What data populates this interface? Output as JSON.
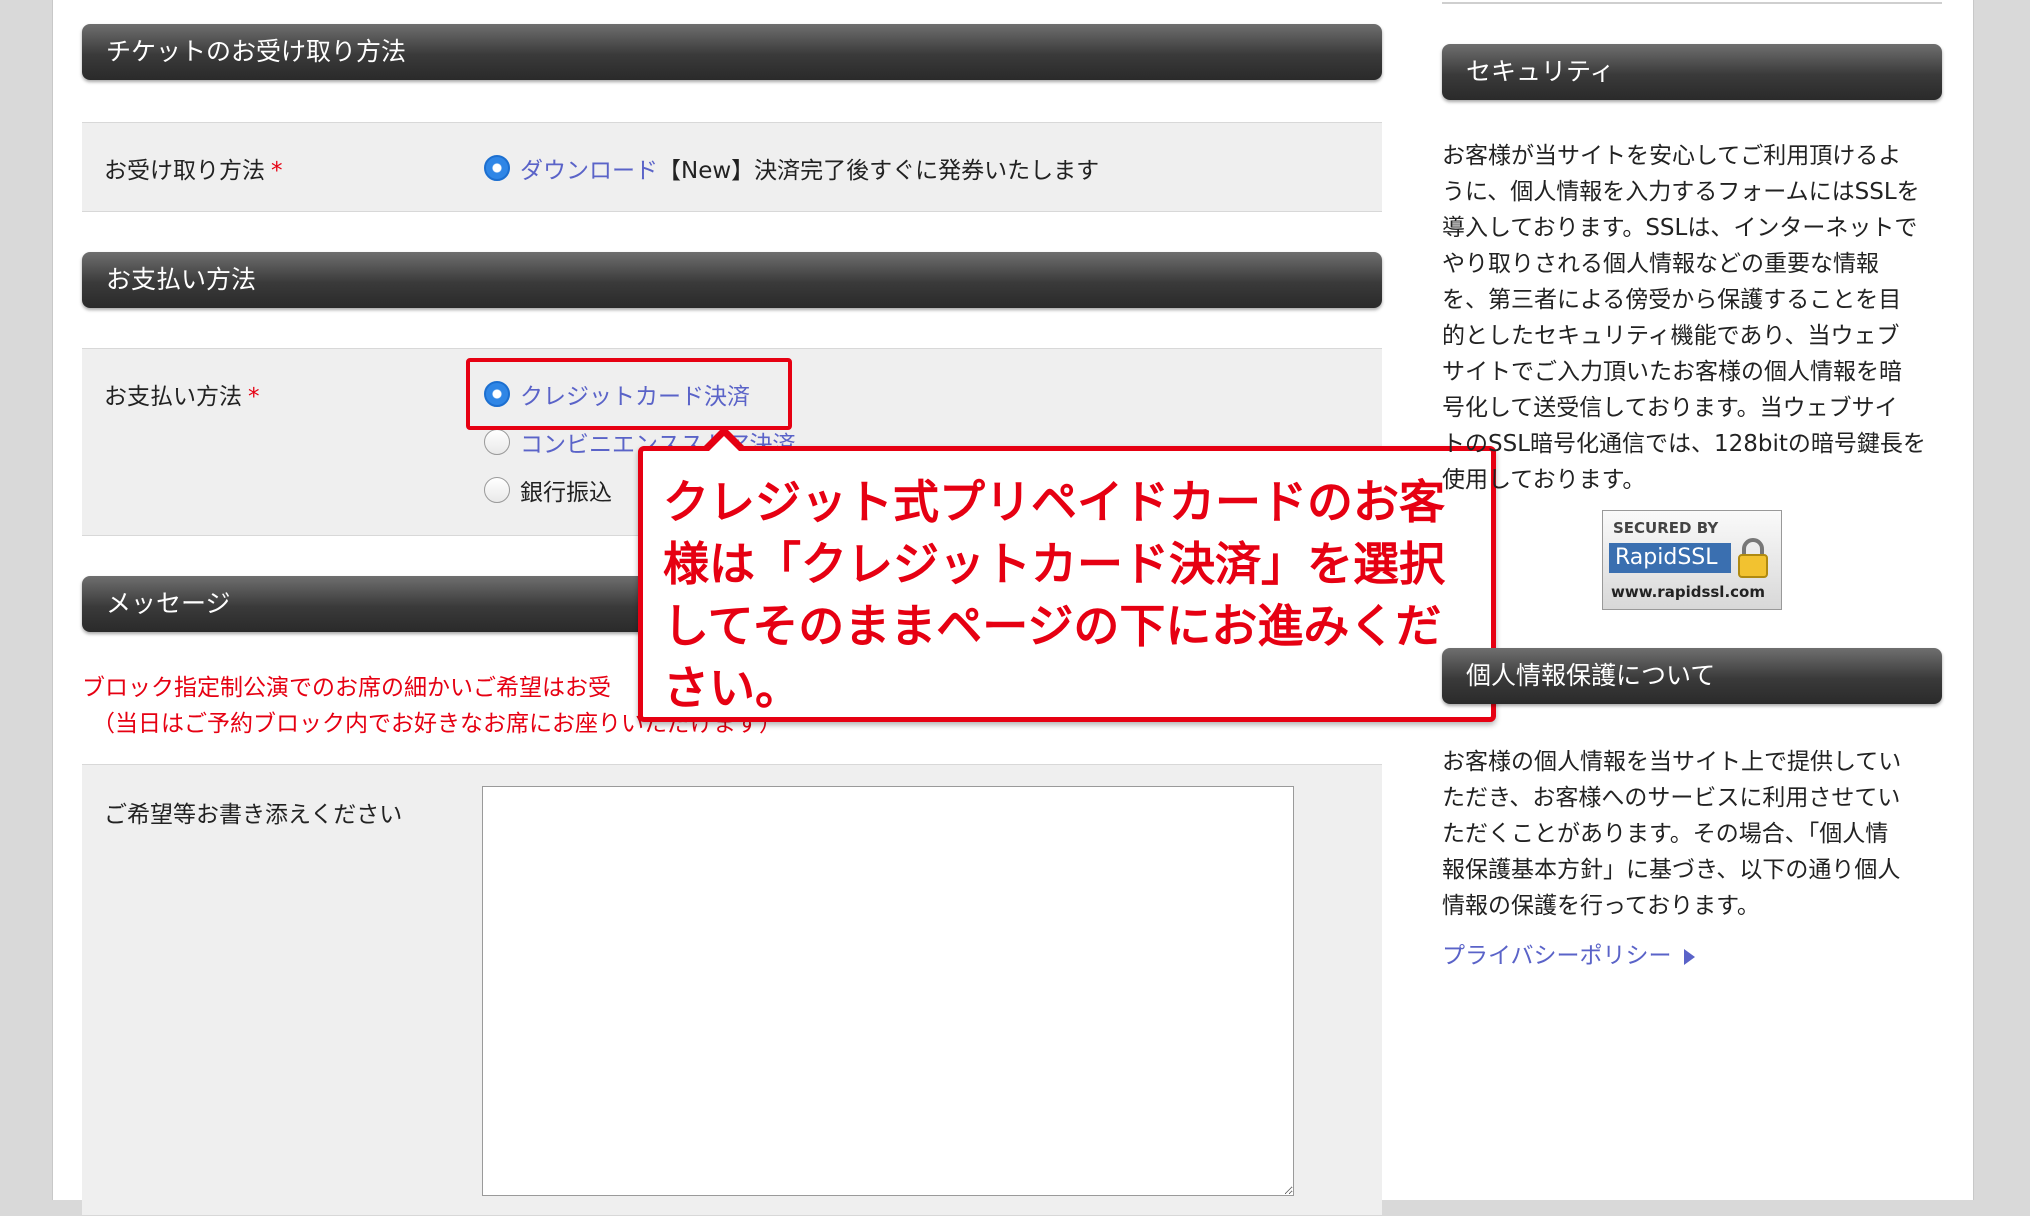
{
  "main": {
    "section_ticket": "チケットのお受け取り方法",
    "receive_label": "お受け取り方法",
    "required_mark": "*",
    "receive_option_link": "ダウンロード",
    "receive_option_text": "【New】決済完了後すぐに発券いたします",
    "section_payment": "お支払い方法",
    "payment_label": "お支払い方法",
    "payment_options": [
      "クレジットカード決済",
      "コンビニエンスストア決済",
      "銀行振込"
    ],
    "section_message": "メッセージ",
    "message_note_line1": "ブロック指定制公演でのお席の細かいご希望はお受",
    "message_note_line2": "（当日はご予約ブロック内でお好きなお席にお座りいただけます）",
    "message_field_label": "ご希望等お書き添えください"
  },
  "callout": {
    "text": "クレジット式プリペイドカードのお客様は「クレジットカード決済」を選択してそのままページの下にお進みください。"
  },
  "sidebar": {
    "security_title": "セキュリティ",
    "security_lines": [
      "お客様が当サイトを安心してご利用頂けるよ",
      "うに、個人情報を入力するフォームにはSSLを",
      "導入しております。SSLは、インターネットで",
      "やり取りされる個人情報などの重要な情報",
      "を、第三者による傍受から保護することを目",
      "的としたセキュリティ機能であり、当ウェブ",
      "サイトでご入力頂いたお客様の個人情報を暗",
      "号化して送受信しております。当ウェブサイ",
      "トのSSL暗号化通信では、128bitの暗号鍵長を",
      "使用しております。"
    ],
    "ssl_badge": {
      "line1": "SECURED BY",
      "line2": "RapidSSL",
      "line3": "www.rapidssl.com"
    },
    "privacy_title": "個人情報保護について",
    "privacy_lines": [
      "お客様の個人情報を当サイト上で提供してい",
      "ただき、お客様へのサービスに利用させてい",
      "ただくことがあります。その場合、「個人情",
      "報保護基本方針」に基づき、以下の通り個人",
      "情報の保護を行っております。"
    ],
    "privacy_link": "プライバシーポリシー"
  },
  "colors": {
    "accent_red": "#e60012",
    "link": "#5a63c8"
  }
}
